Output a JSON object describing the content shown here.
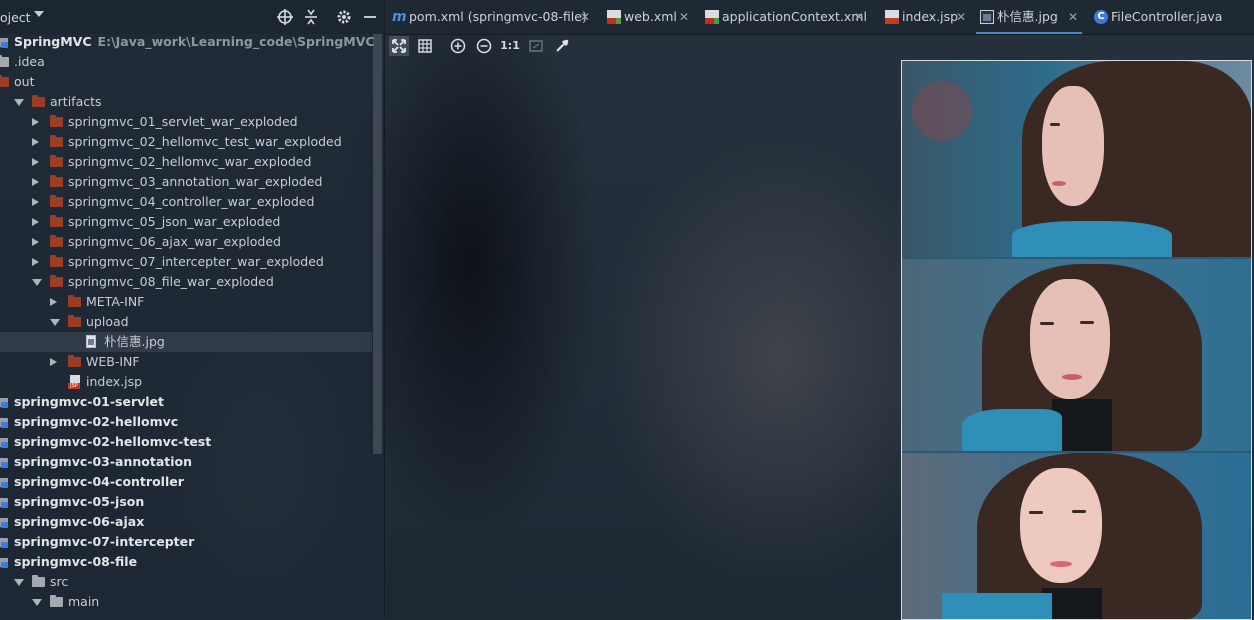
{
  "project_panel": {
    "title": "oject",
    "tree": [
      {
        "label": "SpringMVC",
        "path": "E:\\Java_work\\Learning_code\\SpringMVC",
        "level": 0,
        "icon": "module-icon",
        "arrow": "none",
        "bold": true
      },
      {
        "label": ".idea",
        "level": 0,
        "icon": "folder-grey",
        "arrow": "none"
      },
      {
        "label": "out",
        "level": 0,
        "icon": "folder-brown",
        "arrow": "none"
      },
      {
        "label": "artifacts",
        "level": 1,
        "icon": "folder-brown",
        "arrow": "down"
      },
      {
        "label": "springmvc_01_servlet_war_exploded",
        "level": 2,
        "icon": "folder-brown",
        "arrow": "right"
      },
      {
        "label": "springmvc_02_hellomvc_test_war_exploded",
        "level": 2,
        "icon": "folder-brown",
        "arrow": "right"
      },
      {
        "label": "springmvc_02_hellomvc_war_exploded",
        "level": 2,
        "icon": "folder-brown",
        "arrow": "right"
      },
      {
        "label": "springmvc_03_annotation_war_exploded",
        "level": 2,
        "icon": "folder-brown",
        "arrow": "right"
      },
      {
        "label": "springmvc_04_controller_war_exploded",
        "level": 2,
        "icon": "folder-brown",
        "arrow": "right"
      },
      {
        "label": "springmvc_05_json_war_exploded",
        "level": 2,
        "icon": "folder-brown",
        "arrow": "right"
      },
      {
        "label": "springmvc_06_ajax_war_exploded",
        "level": 2,
        "icon": "folder-brown",
        "arrow": "right"
      },
      {
        "label": "springmvc_07_intercepter_war_exploded",
        "level": 2,
        "icon": "folder-brown",
        "arrow": "right"
      },
      {
        "label": "springmvc_08_file_war_exploded",
        "level": 2,
        "icon": "folder-brown",
        "arrow": "down"
      },
      {
        "label": "META-INF",
        "level": 3,
        "icon": "folder-brown",
        "arrow": "right"
      },
      {
        "label": "upload",
        "level": 3,
        "icon": "folder-brown",
        "arrow": "down"
      },
      {
        "label": "朴信惠.jpg",
        "level": 4,
        "icon": "image-file-icon",
        "arrow": "none",
        "selected": true
      },
      {
        "label": "WEB-INF",
        "level": 3,
        "icon": "folder-brown",
        "arrow": "right"
      },
      {
        "label": "index.jsp",
        "level": 3,
        "icon": "jsp-file-icon",
        "arrow": "none"
      },
      {
        "label": "springmvc-01-servlet",
        "level": 0,
        "icon": "module-icon",
        "arrow": "none",
        "bold": true
      },
      {
        "label": "springmvc-02-hellomvc",
        "level": 0,
        "icon": "module-icon",
        "arrow": "none",
        "bold": true
      },
      {
        "label": "springmvc-02-hellomvc-test",
        "level": 0,
        "icon": "module-icon",
        "arrow": "none",
        "bold": true
      },
      {
        "label": "springmvc-03-annotation",
        "level": 0,
        "icon": "module-icon",
        "arrow": "none",
        "bold": true
      },
      {
        "label": "springmvc-04-controller",
        "level": 0,
        "icon": "module-icon",
        "arrow": "none",
        "bold": true
      },
      {
        "label": "springmvc-05-json",
        "level": 0,
        "icon": "module-icon",
        "arrow": "none",
        "bold": true
      },
      {
        "label": "springmvc-06-ajax",
        "level": 0,
        "icon": "module-icon",
        "arrow": "none",
        "bold": true
      },
      {
        "label": "springmvc-07-intercepter",
        "level": 0,
        "icon": "module-icon",
        "arrow": "none",
        "bold": true
      },
      {
        "label": "springmvc-08-file",
        "level": 0,
        "icon": "module-icon",
        "arrow": "none",
        "bold": true
      },
      {
        "label": "src",
        "level": 1,
        "icon": "folder-grey",
        "arrow": "down"
      },
      {
        "label": "main",
        "level": 2,
        "icon": "folder-grey",
        "arrow": "down"
      }
    ]
  },
  "editor_tabs": [
    {
      "label": "pom.xml (springmvc-08-file)",
      "icon": "maven-icon"
    },
    {
      "label": "web.xml",
      "icon": "xml-file-icon"
    },
    {
      "label": "applicationContext.xml",
      "icon": "xml-file-icon"
    },
    {
      "label": "index.jsp",
      "icon": "jsp-file-icon"
    },
    {
      "label": "朴信惠.jpg",
      "icon": "image-file-icon",
      "active": true
    },
    {
      "label": "FileController.java",
      "icon": "java-class-icon"
    }
  ],
  "image_toolbar": {
    "actual_size_label": "1:1"
  },
  "colors": {
    "accent": "#4a88c7",
    "folder": "#9c3d22",
    "module": "#3d7be0"
  }
}
